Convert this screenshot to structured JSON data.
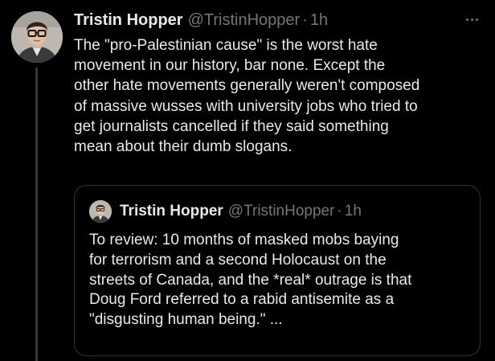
{
  "tweet": {
    "author": {
      "name": "Tristin Hopper",
      "handle": "@TristinHopper",
      "separator": "·",
      "time": "1h"
    },
    "text_lines": [
      "The \"pro-Palestinian cause\" is the worst hate",
      "movement in our history, bar none. Except the",
      "other hate movements generally weren't composed",
      "of massive wusses with university jobs who tried to",
      "get journalists cancelled if they said something",
      "mean about their dumb slogans."
    ],
    "more_icon": "more-horizontal-icon"
  },
  "quoted_tweet": {
    "author": {
      "name": "Tristin Hopper",
      "handle": "@TristinHopper",
      "separator": "·",
      "time": "1h"
    },
    "text_lines": [
      "To review: 10 months of masked mobs baying",
      "for terrorism and a second Holocaust on the",
      "streets of Canada, and the *real* outrage is that",
      "Doug Ford referred to a rabid antisemite as a",
      "\"disgusting human being.\" ..."
    ]
  },
  "colors": {
    "background": "#000000",
    "text_primary": "#e7e9ea",
    "text_secondary": "#71767b",
    "border": "#2f3336"
  }
}
